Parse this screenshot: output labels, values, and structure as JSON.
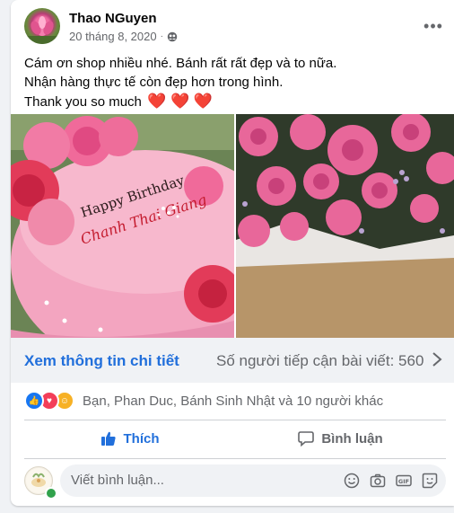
{
  "post": {
    "author": "Thao NGuyen",
    "date": "20 tháng 8, 2020",
    "more_icon": "more-horizontal-icon",
    "lines": [
      "Cám ơn shop nhiều nhé. Bánh rất rất đẹp và to nữa.",
      "Nhận hàng thực tế còn đẹp hơn trong hình.",
      "Thank you so much"
    ],
    "hearts": "❤️ ❤️ ❤️"
  },
  "photos": {
    "cake_text_line1": "Happy Birthday",
    "cake_text_line2": "Chanh Thai Giang"
  },
  "cta": {
    "link": "Xem thông tin chi tiết",
    "reach": "Số người tiếp cận bài viết: 560"
  },
  "reactions": {
    "summary": "Bạn, Phan Duc, Bánh Sinh Nhật và 10 người khác"
  },
  "actions": {
    "like": "Thích",
    "comment": "Bình luận"
  },
  "composer": {
    "placeholder": "Viết bình luận..."
  },
  "colors": {
    "accent": "#216fdb",
    "like_blue": "#1877f2",
    "love_red": "#f33e58",
    "care_yellow": "#f7b125"
  }
}
